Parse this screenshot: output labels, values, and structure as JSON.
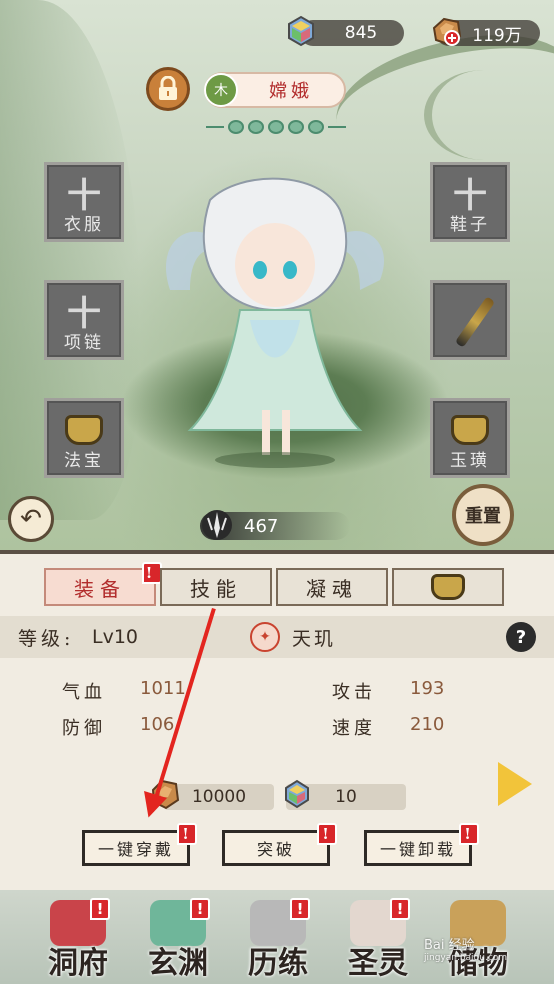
{
  "currency": {
    "gems": "845",
    "coins": "119万"
  },
  "character": {
    "name": "嫦娥",
    "element": "木",
    "power": "467"
  },
  "slots": {
    "clothes": "衣服",
    "shoes": "鞋子",
    "necklace": "项链",
    "treasure": "法宝",
    "jade": "玉璜"
  },
  "buttons": {
    "reset": "重置"
  },
  "tabs": [
    {
      "label": "装备",
      "badge": "!"
    },
    {
      "label": "技能",
      "badge": ""
    },
    {
      "label": "凝魂",
      "badge": ""
    }
  ],
  "info": {
    "level_label": "等级:",
    "level_value": "Lv10",
    "skill_name": "天玑",
    "help": "?"
  },
  "stats": [
    {
      "label": "气血",
      "value": "1011"
    },
    {
      "label": "攻击",
      "value": "193"
    },
    {
      "label": "防御",
      "value": "106"
    },
    {
      "label": "速度",
      "value": "210"
    }
  ],
  "cost": {
    "gold": "10000",
    "gems": "10"
  },
  "actions": [
    {
      "label": "一键穿戴",
      "badge": "!"
    },
    {
      "label": "突破",
      "badge": "!"
    },
    {
      "label": "一键卸载",
      "badge": "!"
    }
  ],
  "nav": [
    {
      "label": "洞府",
      "badge": "!"
    },
    {
      "label": "玄渊",
      "badge": "!"
    },
    {
      "label": "历练",
      "badge": "!"
    },
    {
      "label": "圣灵",
      "badge": "!"
    },
    {
      "label": "储物",
      "badge": ""
    }
  ],
  "watermark": {
    "line1": "Bai 经验",
    "line2": "jingyan.baidu.com"
  },
  "colors": {
    "name_red": "#b22d2d",
    "badge_red": "#d8262a",
    "arrow_red": "#e3251f",
    "gold": "#f2c43a"
  }
}
